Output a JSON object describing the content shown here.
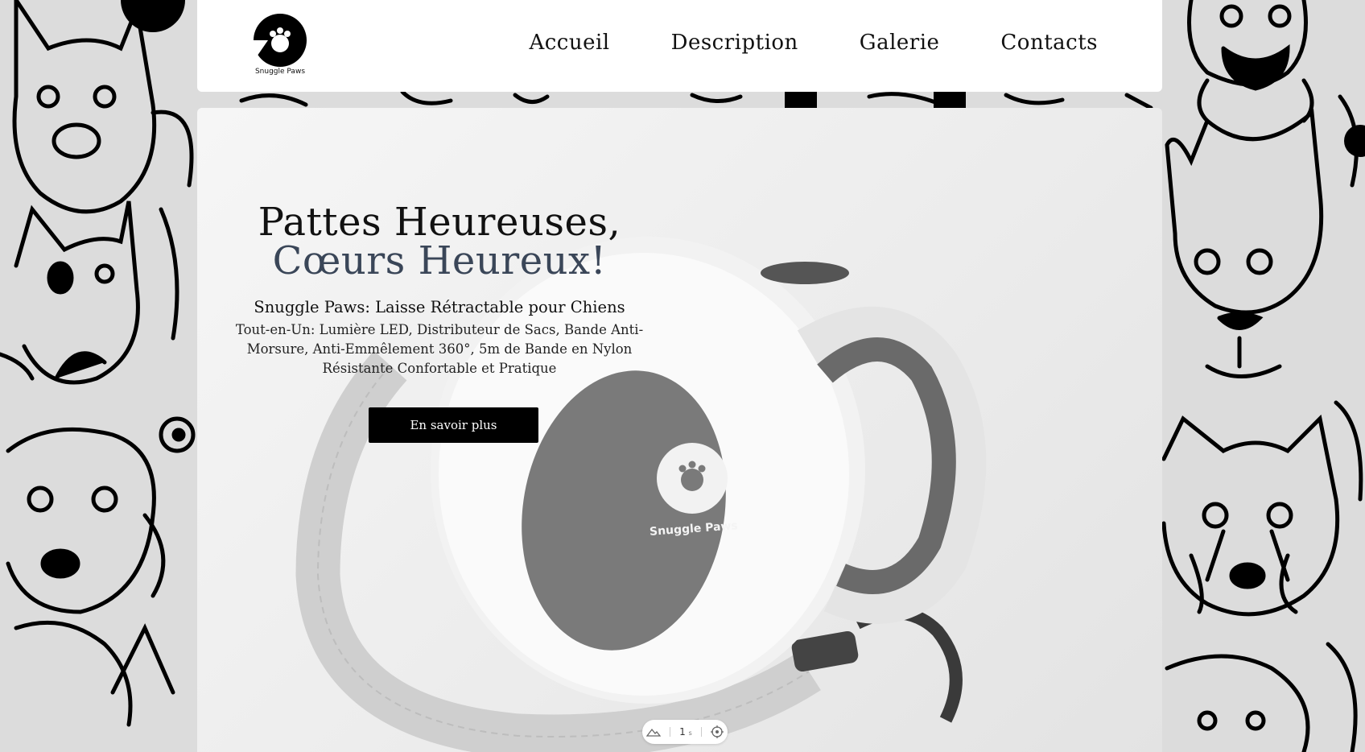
{
  "brand": {
    "name": "Snuggle Paws"
  },
  "nav": {
    "items": [
      {
        "label": "Accueil"
      },
      {
        "label": "Description"
      },
      {
        "label": "Galerie"
      },
      {
        "label": "Contacts"
      }
    ]
  },
  "hero": {
    "title_line1": "Pattes Heureuses,",
    "title_line2": "Cœurs Heureux!",
    "subtitle": "Snuggle Paws: Laisse Rétractable pour Chiens",
    "description": "Tout-en-Un: Lumière LED, Distributeur de Sacs, Bande Anti-Morsure, Anti-Emmêlement 360°, 5m de Bande en Nylon Résistante Confortable et Pratique",
    "cta_label": "En savoir plus",
    "product_logo_text": "Snuggle Paws"
  },
  "toolbar": {
    "counter": "1",
    "unit": "s"
  },
  "colors": {
    "accent": "#3a4658",
    "button": "#000000",
    "header_bg": "#ffffff"
  },
  "icons": [
    "paw-logo-icon",
    "mountain-icon",
    "target-icon"
  ]
}
